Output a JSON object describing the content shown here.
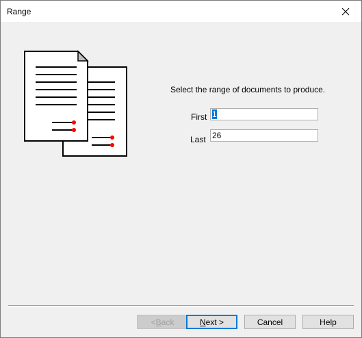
{
  "window": {
    "title": "Range"
  },
  "main": {
    "prompt": "Select the range of documents to produce.",
    "first_label": "First",
    "first_value": "1",
    "last_label": "Last",
    "last_value": "26"
  },
  "buttons": {
    "back_prefix": "< ",
    "back_key": "B",
    "back_rest": "ack",
    "next_key": "N",
    "next_rest": "ext >",
    "cancel": "Cancel",
    "help": "Help"
  },
  "icons": {
    "close": "close-icon",
    "illustration": "documents-illustration"
  },
  "colors": {
    "accent": "#0078d7",
    "marker": "#ff0000"
  }
}
